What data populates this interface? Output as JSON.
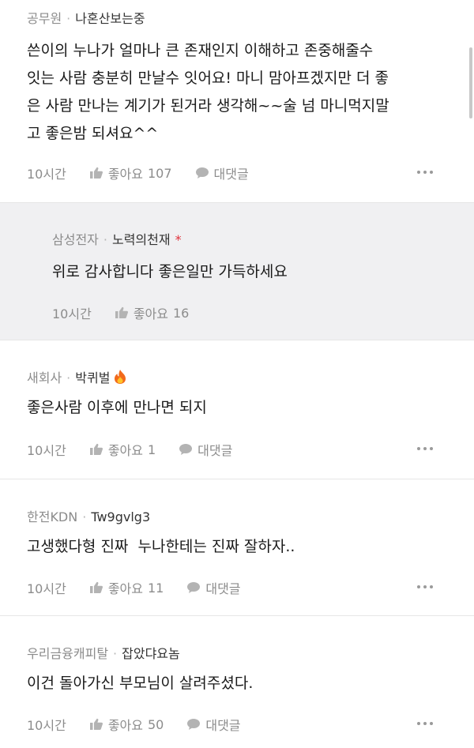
{
  "comments": [
    {
      "company": "공무원",
      "nickname": "나혼산보는중",
      "lines": [
        "쓴이의 누나가 얼마나 큰 존재인지 이해하고 존중해줄수",
        "잇는 사람 충분히 만날수 잇어요! 마니 맘아프겠지만 더 좋",
        "은 사람 만나는 계기가 된거라 생각해~~술 넘 마니먹지말",
        "고 좋은밤 되셔요^^"
      ],
      "time": "10시간",
      "like_label": "좋아요",
      "like_count": "107",
      "reply_label": "대댓글"
    },
    {
      "company": "삼성전자",
      "nickname": "노력의천재",
      "lines": [
        "위로 감사합니다 좋은일만 가득하세요"
      ],
      "time": "10시간",
      "like_label": "좋아요",
      "like_count": "16"
    },
    {
      "company": "새회사",
      "nickname": "박퀴벌",
      "lines": [
        "좋은사람 이후에 만나면 되지"
      ],
      "time": "10시간",
      "like_label": "좋아요",
      "like_count": "1",
      "reply_label": "대댓글"
    },
    {
      "company": "한전KDN",
      "nickname": "Tw9gvlg3",
      "lines": [
        "고생했다형 진짜  누나한테는 진짜 잘하자.."
      ],
      "time": "10시간",
      "like_label": "좋아요",
      "like_count": "11",
      "reply_label": "대댓글"
    },
    {
      "company": "우리금융캐피탈",
      "nickname": "잡았댜요놈",
      "lines": [
        "이건 돌아가신 부모님이 살려주셨다."
      ],
      "time": "10시간",
      "like_label": "좋아요",
      "like_count": "50",
      "reply_label": "대댓글"
    }
  ],
  "colors": {
    "reply_background": "#f0f0f2",
    "author_star": "#e0313b",
    "meta_text": "#8c8c8c"
  }
}
